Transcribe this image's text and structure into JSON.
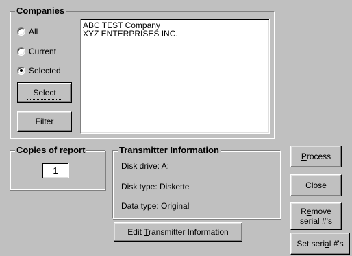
{
  "companies": {
    "title": "Companies",
    "options": [
      {
        "label": "All",
        "checked": false
      },
      {
        "label": "Current",
        "checked": false
      },
      {
        "label": "Selected",
        "checked": true
      }
    ],
    "select_button": "Select",
    "filter_button": "Filter",
    "list": [
      "ABC TEST Company",
      "XYZ ENTERPRISES INC."
    ]
  },
  "copies": {
    "title": "Copies of report",
    "value": "1"
  },
  "transmitter": {
    "title": "Transmitter Information",
    "lines": [
      "Disk drive: A:",
      "Disk type: Diskette",
      "Data type: Original"
    ],
    "edit_button_pre": "Edit ",
    "edit_button_mnemonic": "T",
    "edit_button_post": "ransmitter Information"
  },
  "actions": {
    "process_mnemonic": "P",
    "process_rest": "rocess",
    "close_mnemonic": "C",
    "close_rest": "lose",
    "remove_pre": "R",
    "remove_mnemonic": "e",
    "remove_post": "move",
    "remove_line2": "serial #'s",
    "set_pre": "Set seri",
    "set_mnemonic": "a",
    "set_post": "l #'s"
  }
}
